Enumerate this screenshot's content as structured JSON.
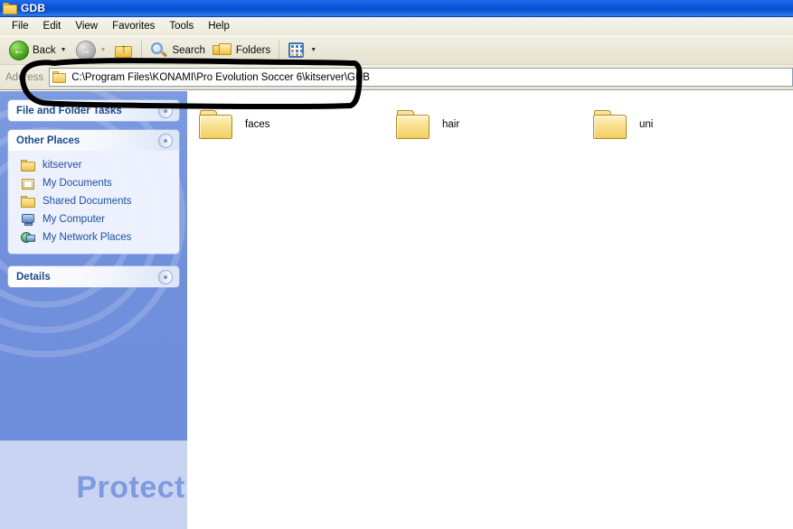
{
  "window": {
    "title": "GDB",
    "title_icon": "folder-icon"
  },
  "menu": {
    "items": [
      {
        "label": "File"
      },
      {
        "label": "Edit"
      },
      {
        "label": "View"
      },
      {
        "label": "Favorites"
      },
      {
        "label": "Tools"
      },
      {
        "label": "Help"
      }
    ]
  },
  "toolbar": {
    "back_label": "Back",
    "back_icon": "back-arrow-icon",
    "forward_icon": "forward-arrow-icon",
    "up_icon": "up-one-level-icon",
    "search_label": "Search",
    "search_icon": "search-icon",
    "folders_label": "Folders",
    "folders_icon": "folders-icon",
    "views_icon": "views-icon",
    "dropdown_caret": "▼"
  },
  "address": {
    "label": "Address",
    "icon": "folder-icon",
    "value": "C:\\Program Files\\KONAMI\\Pro Evolution Soccer 6\\kitserver\\GDB"
  },
  "sidebar": {
    "panels": [
      {
        "title": "File and Folder Tasks",
        "collapsed": true,
        "chevron": "»"
      },
      {
        "title": "Other Places",
        "collapsed": false,
        "chevron": "«",
        "items": [
          {
            "label": "kitserver",
            "icon": "folder-icon"
          },
          {
            "label": "My Documents",
            "icon": "my-documents-icon"
          },
          {
            "label": "Shared Documents",
            "icon": "folder-icon"
          },
          {
            "label": "My Computer",
            "icon": "my-computer-icon"
          },
          {
            "label": "My Network Places",
            "icon": "my-network-places-icon"
          }
        ]
      },
      {
        "title": "Details",
        "collapsed": true,
        "chevron": "»"
      }
    ],
    "watermark": "Protect"
  },
  "content": {
    "items": [
      {
        "label": "faces",
        "icon": "folder-icon"
      },
      {
        "label": "hair",
        "icon": "folder-icon"
      },
      {
        "label": "uni",
        "icon": "folder-icon"
      }
    ]
  },
  "annotation": {
    "shape": "hand-drawn-ellipse",
    "color": "#000000",
    "target": "address-bar"
  },
  "colors": {
    "titlebar": "#0a53d8",
    "toolbar": "#ece9d8",
    "sidebar": "#7190dc",
    "sidebar_link": "#1d4f9e",
    "watermark_band": "#c8d4f2",
    "watermark_text": "#7f9ae0",
    "content_bg": "#ffffff"
  }
}
